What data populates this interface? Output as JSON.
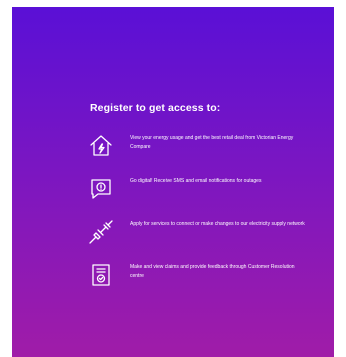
{
  "section": {
    "heading": "Register to get access to:"
  },
  "benefits": [
    {
      "icon": "house-lightning-icon",
      "text": "View your energy usage and get the best retail deal from Victorian Energy Compare"
    },
    {
      "icon": "chat-alert-icon",
      "text": "Go digital! Receive SMS and email notifications for outages"
    },
    {
      "icon": "plug-icon",
      "text": "Apply for services to connect or make changes to our electricity supply network"
    },
    {
      "icon": "document-claim-icon",
      "text": "Make and view claims and provide feedback through Customer Resolution centre"
    }
  ],
  "colors": {
    "gradient_top": "#5a10d6",
    "gradient_bottom": "#a01ca8",
    "text": "#ffffff"
  }
}
